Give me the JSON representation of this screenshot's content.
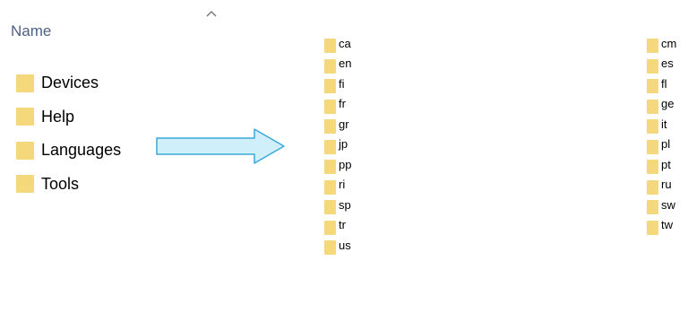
{
  "header": {
    "column_name": "Name",
    "sort_icon": "chevron-up-icon"
  },
  "left_folders": [
    {
      "label": "Devices"
    },
    {
      "label": "Help"
    },
    {
      "label": "Languages"
    },
    {
      "label": "Tools"
    }
  ],
  "arrow": {
    "icon": "arrow-right-icon",
    "fill_color": "#cfeffb",
    "stroke_color": "#3aa8d8"
  },
  "folder_color": "#f5d77c",
  "middle_folders": [
    {
      "label": "ca"
    },
    {
      "label": "en"
    },
    {
      "label": "fi"
    },
    {
      "label": "fr"
    },
    {
      "label": "gr"
    },
    {
      "label": "jp"
    },
    {
      "label": "pp"
    },
    {
      "label": "ri"
    },
    {
      "label": "sp"
    },
    {
      "label": "tr"
    },
    {
      "label": "us"
    }
  ],
  "right_folders": [
    {
      "label": "cm"
    },
    {
      "label": "es"
    },
    {
      "label": "fl"
    },
    {
      "label": "ge"
    },
    {
      "label": "it"
    },
    {
      "label": "pl"
    },
    {
      "label": "pt"
    },
    {
      "label": "ru"
    },
    {
      "label": "sw"
    },
    {
      "label": "tw"
    }
  ]
}
